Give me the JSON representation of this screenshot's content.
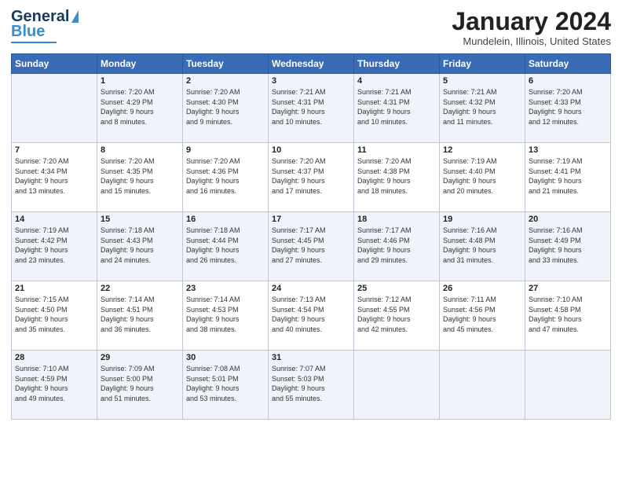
{
  "header": {
    "logo_line1": "General",
    "logo_line2": "Blue",
    "month_title": "January 2024",
    "location": "Mundelein, Illinois, United States"
  },
  "days_of_week": [
    "Sunday",
    "Monday",
    "Tuesday",
    "Wednesday",
    "Thursday",
    "Friday",
    "Saturday"
  ],
  "weeks": [
    [
      {
        "num": "",
        "info": ""
      },
      {
        "num": "1",
        "info": "Sunrise: 7:20 AM\nSunset: 4:29 PM\nDaylight: 9 hours\nand 8 minutes."
      },
      {
        "num": "2",
        "info": "Sunrise: 7:20 AM\nSunset: 4:30 PM\nDaylight: 9 hours\nand 9 minutes."
      },
      {
        "num": "3",
        "info": "Sunrise: 7:21 AM\nSunset: 4:31 PM\nDaylight: 9 hours\nand 10 minutes."
      },
      {
        "num": "4",
        "info": "Sunrise: 7:21 AM\nSunset: 4:31 PM\nDaylight: 9 hours\nand 10 minutes."
      },
      {
        "num": "5",
        "info": "Sunrise: 7:21 AM\nSunset: 4:32 PM\nDaylight: 9 hours\nand 11 minutes."
      },
      {
        "num": "6",
        "info": "Sunrise: 7:20 AM\nSunset: 4:33 PM\nDaylight: 9 hours\nand 12 minutes."
      }
    ],
    [
      {
        "num": "7",
        "info": "Sunrise: 7:20 AM\nSunset: 4:34 PM\nDaylight: 9 hours\nand 13 minutes."
      },
      {
        "num": "8",
        "info": "Sunrise: 7:20 AM\nSunset: 4:35 PM\nDaylight: 9 hours\nand 15 minutes."
      },
      {
        "num": "9",
        "info": "Sunrise: 7:20 AM\nSunset: 4:36 PM\nDaylight: 9 hours\nand 16 minutes."
      },
      {
        "num": "10",
        "info": "Sunrise: 7:20 AM\nSunset: 4:37 PM\nDaylight: 9 hours\nand 17 minutes."
      },
      {
        "num": "11",
        "info": "Sunrise: 7:20 AM\nSunset: 4:38 PM\nDaylight: 9 hours\nand 18 minutes."
      },
      {
        "num": "12",
        "info": "Sunrise: 7:19 AM\nSunset: 4:40 PM\nDaylight: 9 hours\nand 20 minutes."
      },
      {
        "num": "13",
        "info": "Sunrise: 7:19 AM\nSunset: 4:41 PM\nDaylight: 9 hours\nand 21 minutes."
      }
    ],
    [
      {
        "num": "14",
        "info": "Sunrise: 7:19 AM\nSunset: 4:42 PM\nDaylight: 9 hours\nand 23 minutes."
      },
      {
        "num": "15",
        "info": "Sunrise: 7:18 AM\nSunset: 4:43 PM\nDaylight: 9 hours\nand 24 minutes."
      },
      {
        "num": "16",
        "info": "Sunrise: 7:18 AM\nSunset: 4:44 PM\nDaylight: 9 hours\nand 26 minutes."
      },
      {
        "num": "17",
        "info": "Sunrise: 7:17 AM\nSunset: 4:45 PM\nDaylight: 9 hours\nand 27 minutes."
      },
      {
        "num": "18",
        "info": "Sunrise: 7:17 AM\nSunset: 4:46 PM\nDaylight: 9 hours\nand 29 minutes."
      },
      {
        "num": "19",
        "info": "Sunrise: 7:16 AM\nSunset: 4:48 PM\nDaylight: 9 hours\nand 31 minutes."
      },
      {
        "num": "20",
        "info": "Sunrise: 7:16 AM\nSunset: 4:49 PM\nDaylight: 9 hours\nand 33 minutes."
      }
    ],
    [
      {
        "num": "21",
        "info": "Sunrise: 7:15 AM\nSunset: 4:50 PM\nDaylight: 9 hours\nand 35 minutes."
      },
      {
        "num": "22",
        "info": "Sunrise: 7:14 AM\nSunset: 4:51 PM\nDaylight: 9 hours\nand 36 minutes."
      },
      {
        "num": "23",
        "info": "Sunrise: 7:14 AM\nSunset: 4:53 PM\nDaylight: 9 hours\nand 38 minutes."
      },
      {
        "num": "24",
        "info": "Sunrise: 7:13 AM\nSunset: 4:54 PM\nDaylight: 9 hours\nand 40 minutes."
      },
      {
        "num": "25",
        "info": "Sunrise: 7:12 AM\nSunset: 4:55 PM\nDaylight: 9 hours\nand 42 minutes."
      },
      {
        "num": "26",
        "info": "Sunrise: 7:11 AM\nSunset: 4:56 PM\nDaylight: 9 hours\nand 45 minutes."
      },
      {
        "num": "27",
        "info": "Sunrise: 7:10 AM\nSunset: 4:58 PM\nDaylight: 9 hours\nand 47 minutes."
      }
    ],
    [
      {
        "num": "28",
        "info": "Sunrise: 7:10 AM\nSunset: 4:59 PM\nDaylight: 9 hours\nand 49 minutes."
      },
      {
        "num": "29",
        "info": "Sunrise: 7:09 AM\nSunset: 5:00 PM\nDaylight: 9 hours\nand 51 minutes."
      },
      {
        "num": "30",
        "info": "Sunrise: 7:08 AM\nSunset: 5:01 PM\nDaylight: 9 hours\nand 53 minutes."
      },
      {
        "num": "31",
        "info": "Sunrise: 7:07 AM\nSunset: 5:03 PM\nDaylight: 9 hours\nand 55 minutes."
      },
      {
        "num": "",
        "info": ""
      },
      {
        "num": "",
        "info": ""
      },
      {
        "num": "",
        "info": ""
      }
    ]
  ]
}
